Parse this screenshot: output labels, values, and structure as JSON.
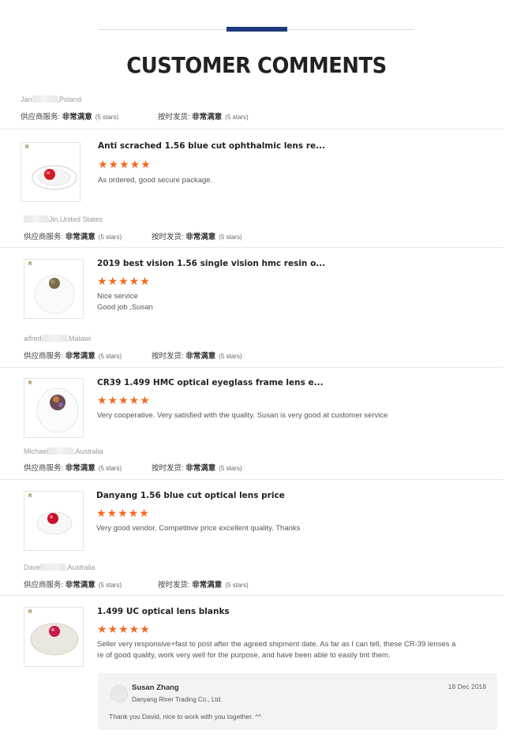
{
  "header": {
    "title": "CUSTOMER COMMENTS"
  },
  "meta_labels": {
    "supplier_service": "供应商服务:",
    "on_time": "按时发货:",
    "very_satisfied": "非常满意",
    "five_stars": "(5 stars)"
  },
  "stars": "★★★★★",
  "reviews": [
    {
      "buyer_first": "Jan",
      "buyer_location": ",Poland",
      "product_title": "Anti scrached 1.56 blue cut ophthalmic lens re...",
      "comment": "As ordered, good secure package."
    },
    {
      "buyer_first": "",
      "buyer_location": "Jin,United States",
      "product_title": "2019 best vision 1.56 single vision hmc resin o...",
      "comment_lines": [
        "Nice service",
        "Good job ,Susan"
      ]
    },
    {
      "buyer_first": "alfred",
      "buyer_location": ",Malawi",
      "product_title": "CR39 1.499 HMC optical eyeglass frame lens e...",
      "comment": "Very cooperative.  Very satisfied with the quality.  Susan is very good at customer service"
    },
    {
      "buyer_first": "Michael",
      "buyer_location": ",Australia",
      "product_title": "Danyang 1.56 blue cut optical lens price",
      "comment": "Very good vendor. Competitive price excellent quality. Thanks"
    },
    {
      "buyer_first": "Dave",
      "buyer_location": ",Australia",
      "product_title": "1.499 UC optical lens blanks",
      "comment_lines": [
        "Seller very responsive+fast to post after the agreed shipment date. As far as I can tell, these CR-39 lenses a",
        "re of good quality, work very well for the purpose, and have been able to easily tint them."
      ]
    }
  ],
  "reply": {
    "name": "Susan Zhang",
    "company": "Danyang River Trading Co., Ltd.",
    "date": "18 Dec 2018",
    "text": "Thank you David, nice to work with you together. ^^"
  },
  "colors": {
    "accent_bar": "#1e3a7b",
    "star": "#f26a21"
  }
}
